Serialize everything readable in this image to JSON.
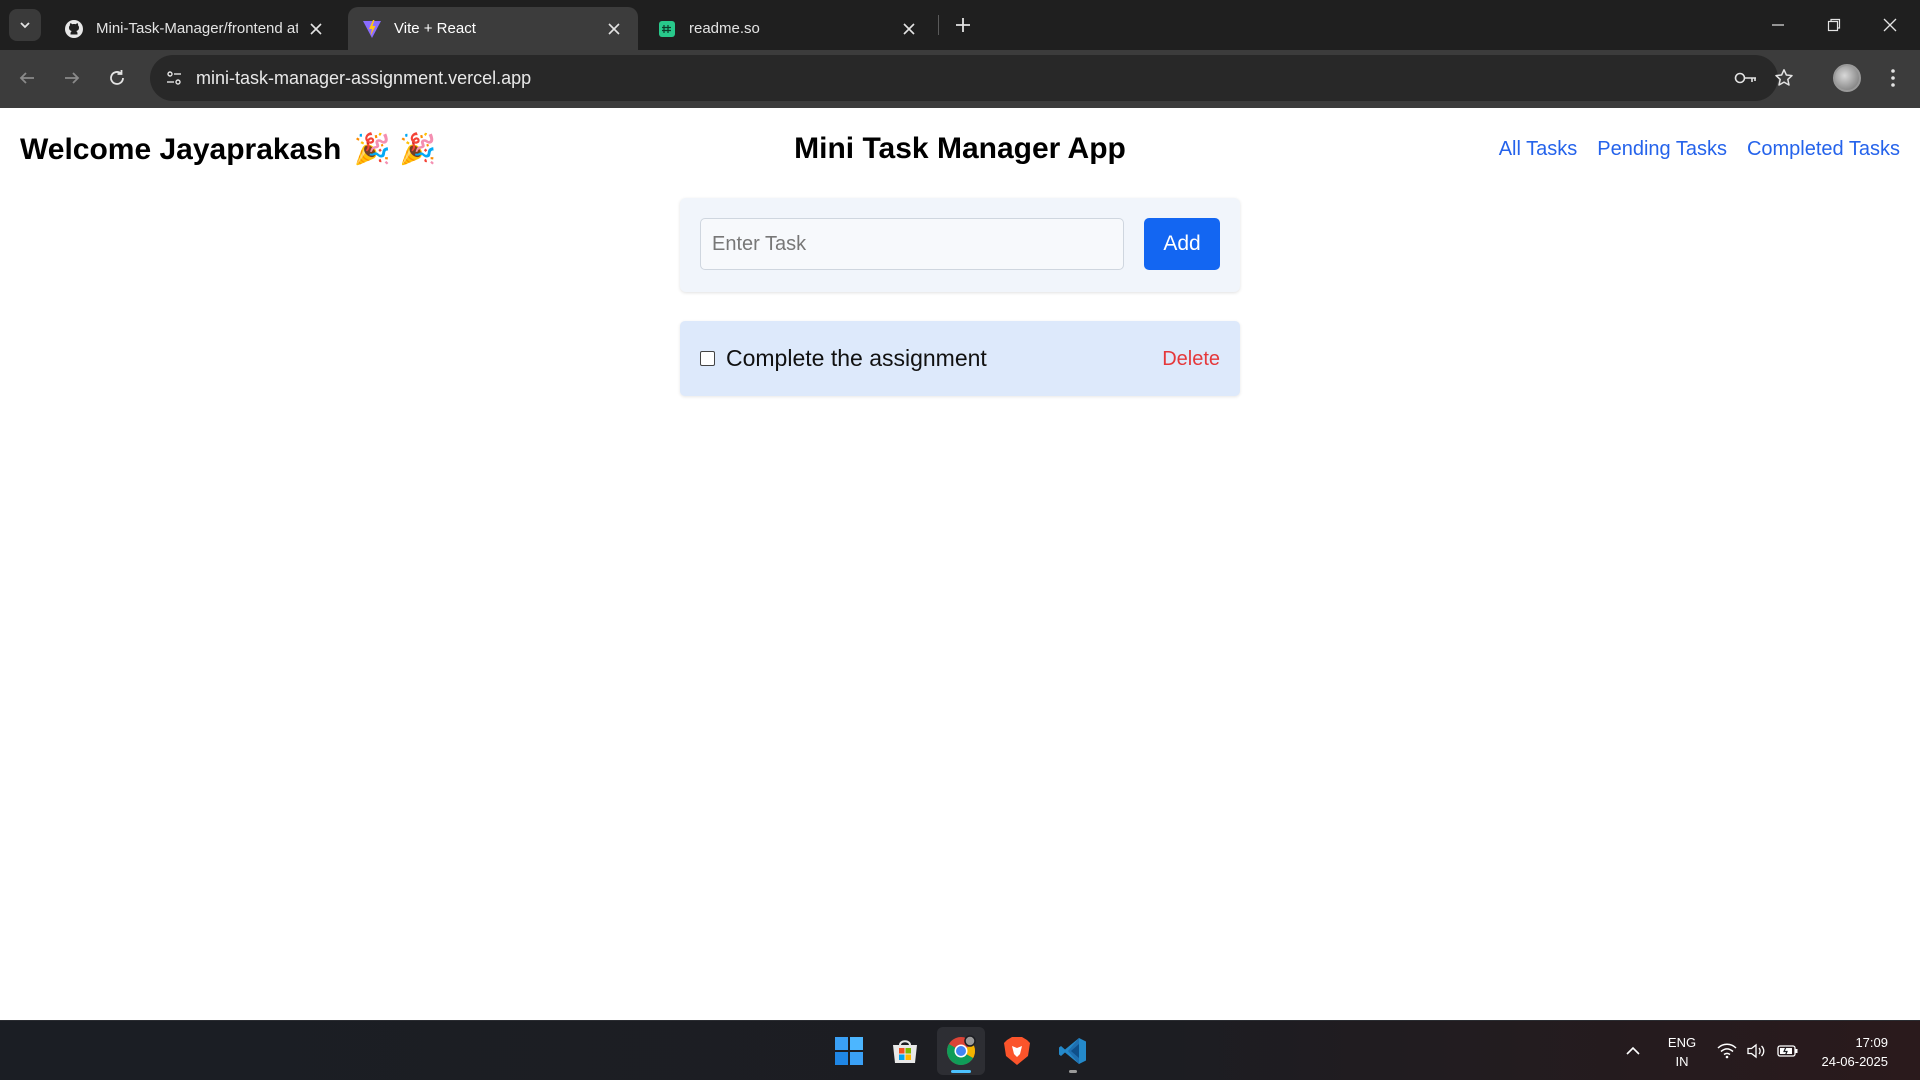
{
  "browser": {
    "tabs": [
      {
        "title": "Mini-Task-Manager/frontend at",
        "favicon": "github-icon",
        "active": false
      },
      {
        "title": "Vite + React",
        "favicon": "vite-icon",
        "active": true
      },
      {
        "title": "readme.so",
        "favicon": "readme-icon",
        "active": false
      }
    ],
    "url": "mini-task-manager-assignment.vercel.app"
  },
  "app": {
    "welcome_text": "Welcome Jayaprakash",
    "welcome_emoji": "🎉 🎉",
    "title": "Mini Task Manager App",
    "nav": {
      "all": "All Tasks",
      "pending": "Pending Tasks",
      "completed": "Completed Tasks"
    },
    "input_placeholder": "Enter Task",
    "add_label": "Add",
    "tasks": [
      {
        "label": "Complete the assignment",
        "completed": false,
        "delete_label": "Delete"
      }
    ],
    "colors": {
      "link": "#2563eb",
      "add_button": "#1366f2",
      "delete": "#e5383b",
      "task_bg": "#dde9fb",
      "form_bg": "#f1f5fb"
    }
  },
  "taskbar": {
    "apps": [
      "windows-start-icon",
      "microsoft-store-icon",
      "chrome-icon",
      "brave-icon",
      "vscode-icon"
    ],
    "lang_line1": "ENG",
    "lang_line2": "IN",
    "time": "17:09",
    "date": "24-06-2025"
  }
}
